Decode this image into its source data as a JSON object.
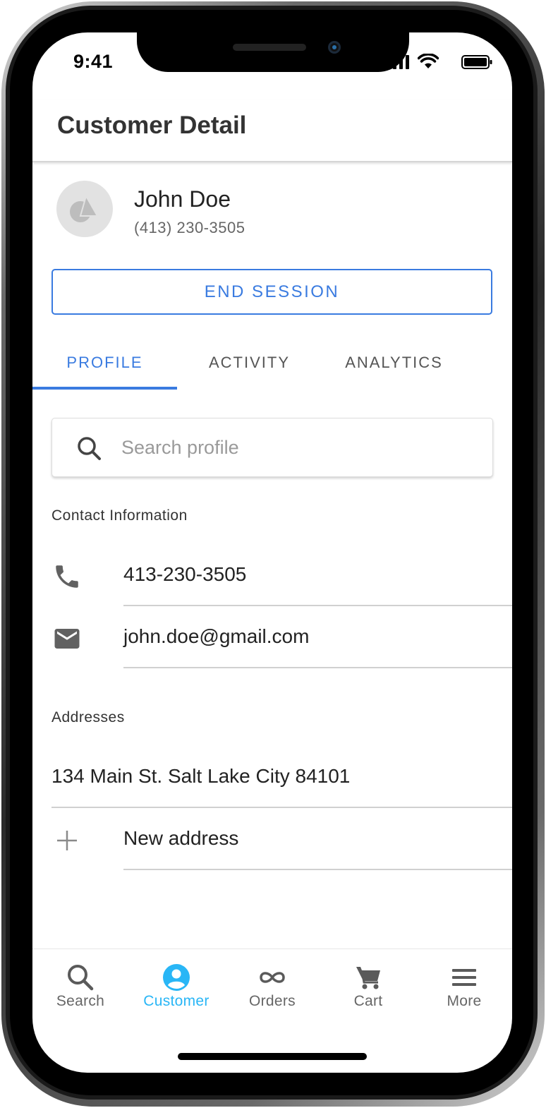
{
  "status_bar": {
    "time": "9:41"
  },
  "header": {
    "title": "Customer Detail"
  },
  "customer": {
    "name": "John Doe",
    "phone": "(413) 230-3505"
  },
  "actions": {
    "end_session_label": "END SESSION"
  },
  "tabs": [
    {
      "label": "PROFILE",
      "active": true
    },
    {
      "label": "ACTIVITY",
      "active": false
    },
    {
      "label": "ANALYTICS",
      "active": false
    }
  ],
  "search": {
    "placeholder": "Search profile",
    "value": ""
  },
  "contact": {
    "section_label": "Contact Information",
    "phone": "413-230-3505",
    "email": "john.doe@gmail.com"
  },
  "addresses": {
    "section_label": "Addresses",
    "items": [
      "134 Main St. Salt Lake City 84101"
    ],
    "new_label": "New address"
  },
  "bottom_nav": [
    {
      "label": "Search",
      "icon": "search-icon",
      "active": false
    },
    {
      "label": "Customer",
      "icon": "account-circle-icon",
      "active": true
    },
    {
      "label": "Orders",
      "icon": "infinity-icon",
      "active": false
    },
    {
      "label": "Cart",
      "icon": "cart-icon",
      "active": false
    },
    {
      "label": "More",
      "icon": "menu-icon",
      "active": false
    }
  ],
  "colors": {
    "accent": "#3a7be0",
    "nav_active": "#29b6f6",
    "text": "#222222",
    "muted": "#666666"
  }
}
